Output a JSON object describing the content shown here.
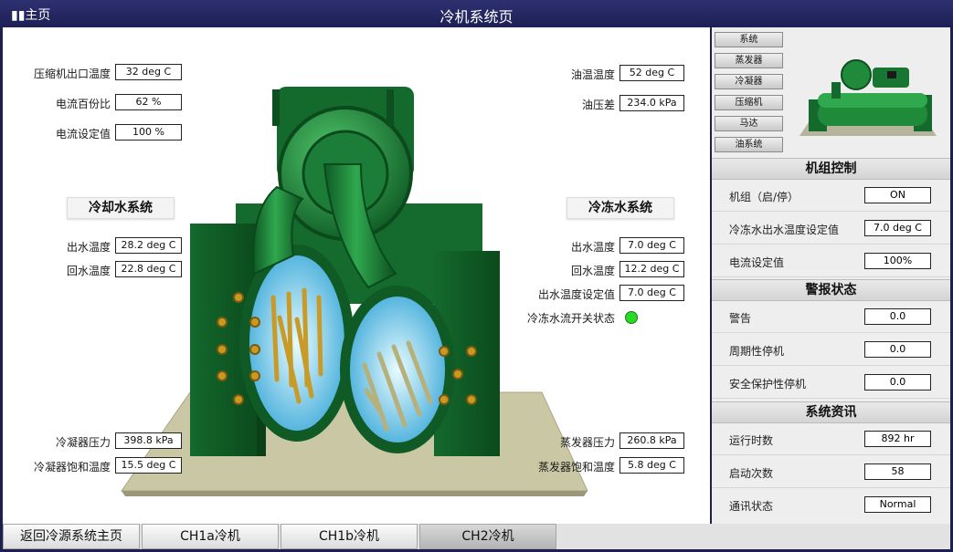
{
  "header": {
    "home_label": "▮▮主页",
    "title": "冷机系统页"
  },
  "left_top": [
    {
      "label": "压缩机出口温度",
      "value": "32 deg C"
    },
    {
      "label": "电流百份比",
      "value": "62 %"
    },
    {
      "label": "电流设定值",
      "value": "100 %"
    }
  ],
  "oil": [
    {
      "label": "油温温度",
      "value": "52 deg C"
    },
    {
      "label": "油压差",
      "value": "234.0 kPa"
    }
  ],
  "cooling_water": {
    "title": "冷却水系统",
    "rows": [
      {
        "label": "出水温度",
        "value": "28.2 deg C"
      },
      {
        "label": "回水温度",
        "value": "22.8 deg C"
      }
    ]
  },
  "chilled_water": {
    "title": "冷冻水系统",
    "rows": [
      {
        "label": "出水温度",
        "value": "7.0 deg C"
      },
      {
        "label": "回水温度",
        "value": "12.2 deg C"
      },
      {
        "label": "出水温度设定值",
        "value": "7.0 deg C"
      }
    ],
    "flow_switch_label": "冷冻水流开关状态",
    "flow_switch_color": "#22dd22"
  },
  "condenser": [
    {
      "label": "冷凝器压力",
      "value": "398.8 kPa"
    },
    {
      "label": "冷凝器饱和温度",
      "value": "15.5 deg C"
    }
  ],
  "evaporator": [
    {
      "label": "蒸发器压力",
      "value": "260.8 kPa"
    },
    {
      "label": "蒸发器饱和温度",
      "value": "5.8 deg C"
    }
  ],
  "nav_buttons": [
    "系统",
    "蒸发器",
    "冷凝器",
    "压缩机",
    "马达",
    "油系统"
  ],
  "unit_control": {
    "title": "机组控制",
    "rows": [
      {
        "label": "机组（启/停）",
        "value": "ON"
      },
      {
        "label": "冷冻水出水温度设定值",
        "value": "7.0 deg C"
      },
      {
        "label": "电流设定值",
        "value": "100%"
      }
    ]
  },
  "alarm_status": {
    "title": "警报状态",
    "rows": [
      {
        "label": "警告",
        "value": "0.0"
      },
      {
        "label": "周期性停机",
        "value": "0.0"
      },
      {
        "label": "安全保护性停机",
        "value": "0.0"
      }
    ]
  },
  "system_info": {
    "title": "系统资讯",
    "rows": [
      {
        "label": "运行时数",
        "value": "892 hr"
      },
      {
        "label": "启动次数",
        "value": "58"
      },
      {
        "label": "通讯状态",
        "value": "Normal"
      }
    ]
  },
  "tabs": [
    {
      "label": "返回冷源系统主页",
      "active": false
    },
    {
      "label": "CH1a冷机",
      "active": false
    },
    {
      "label": "CH1b冷机",
      "active": false
    },
    {
      "label": "CH2冷机",
      "active": true
    }
  ],
  "colors": {
    "header_bg": "#1d1f55",
    "machine_green": "#1f8a3a",
    "platform": "#c9c7a4"
  }
}
